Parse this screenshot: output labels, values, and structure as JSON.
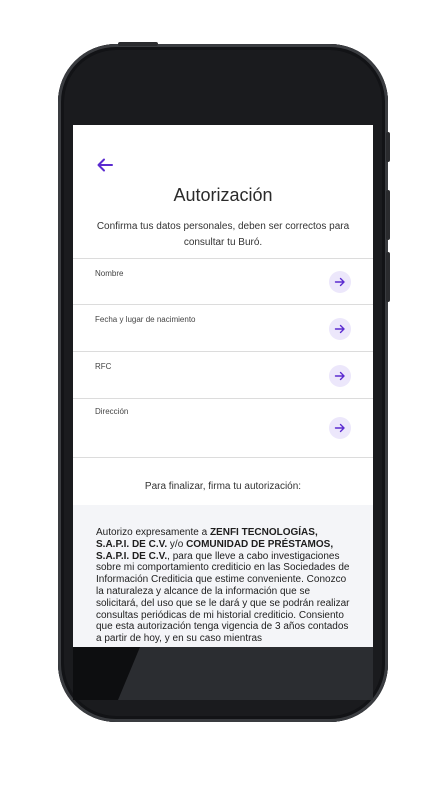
{
  "header": {
    "title": "Autorización"
  },
  "intro": {
    "text": "Confirma tus datos personales, deben ser correctos para consultar tu Buró."
  },
  "fields": [
    {
      "label": "Nombre"
    },
    {
      "label": "Fecha y lugar de nacimiento"
    },
    {
      "label": "RFC"
    },
    {
      "label": "Dirección"
    }
  ],
  "finalize": {
    "text": "Para finalizar, firma tu autorización:"
  },
  "authorization": {
    "p1": "Autorizo expresamente a ",
    "company1": "ZENFI TECNOLOGÍAS, S.A.P.I. DE C.V.",
    "p2": " y/o ",
    "company2": "COMUNIDAD DE PRÉSTAMOS, S.A.P.I. DE C.V.",
    "p3": ", para que lleve a cabo investigaciones sobre mi comportamiento crediticio en las Sociedades de Información Crediticia que estime conveniente. Conozco la naturaleza y alcance de la información que se solicitará, del uso que se le dará y que se podrán realizar consultas periódicas de mi historial crediticio. Consiento que esta autorización tenga vigencia de 3 años contados a partir de hoy, y en su caso mientras"
  },
  "colors": {
    "accent": "#5b2bd0",
    "arrow_bg": "#ece7fb",
    "panel_bg": "#f4f5f8"
  },
  "icons": {
    "back": "arrow-left-icon",
    "go": "arrow-right-icon"
  }
}
